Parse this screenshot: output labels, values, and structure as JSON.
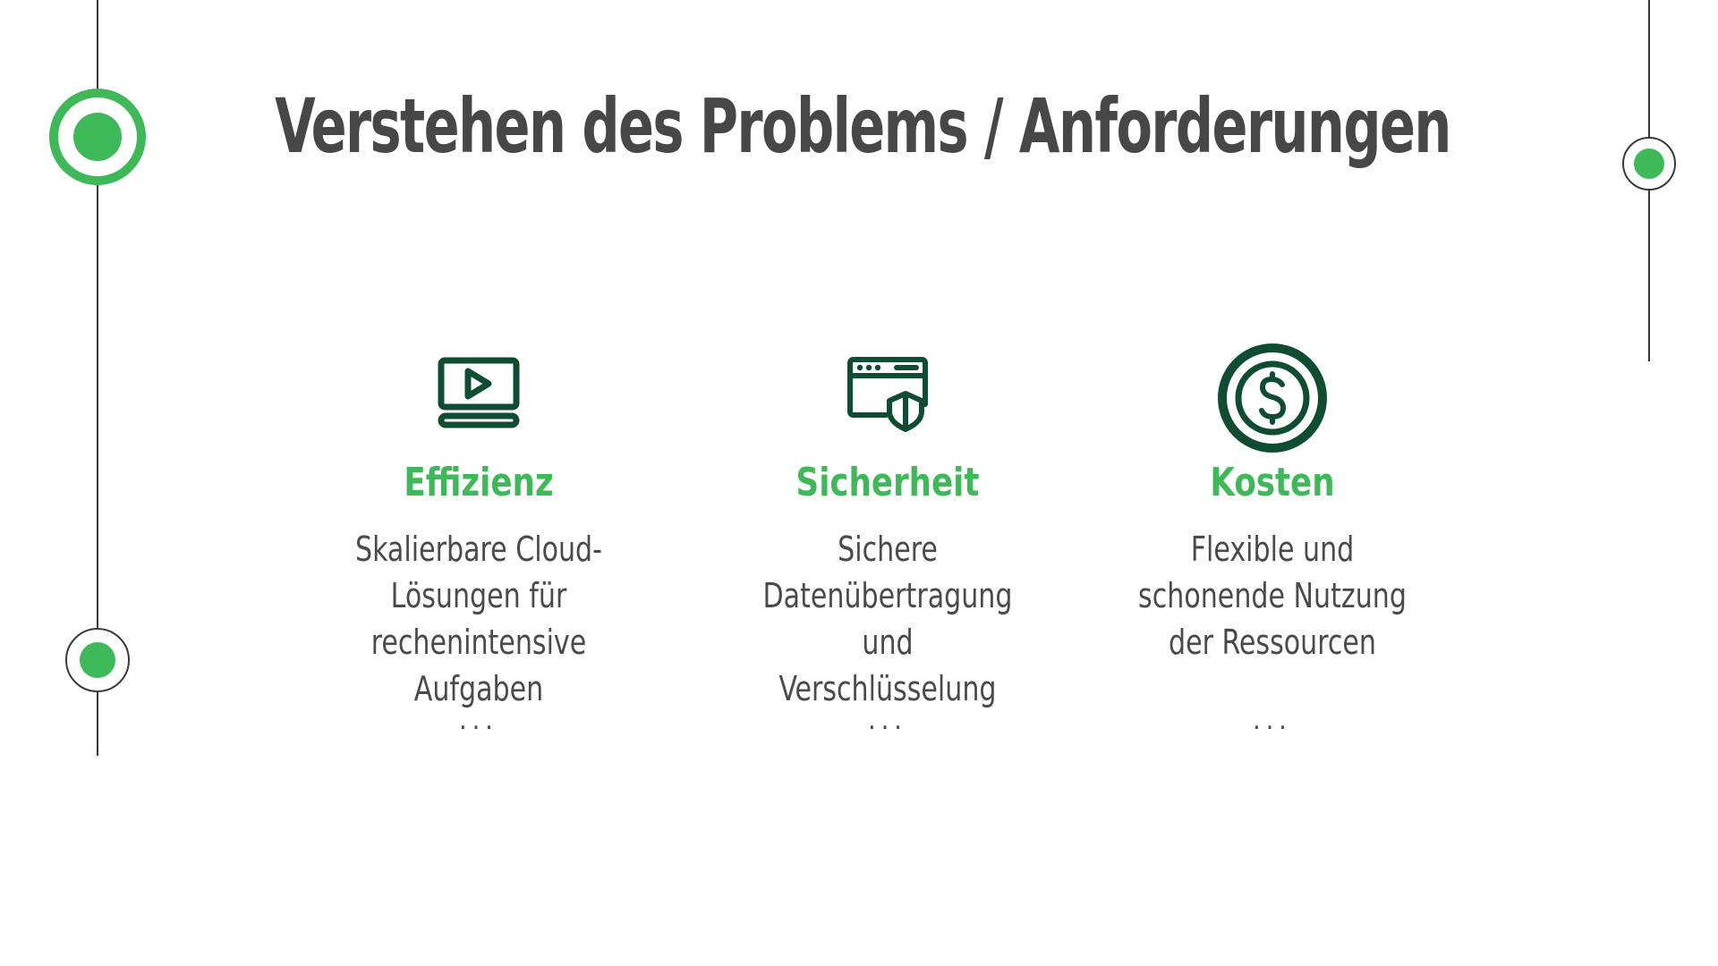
{
  "slide": {
    "title": "Verstehen des Problems / Anforderungen",
    "accent_color": "#3db957",
    "icon_color": "#0f4d33",
    "cards": [
      {
        "icon": "monitor-play-icon",
        "heading": "Effizienz",
        "desc_lines": [
          "Skalierbare Cloud-",
          "Lösungen für",
          "rechenintensive",
          "Aufgaben"
        ],
        "more": "..."
      },
      {
        "icon": "browser-shield-icon",
        "heading": "Sicherheit",
        "desc_lines": [
          "Sichere",
          "Datenübertragung",
          "und",
          "Verschlüsselung"
        ],
        "more": "..."
      },
      {
        "icon": "dollar-coin-icon",
        "heading": "Kosten",
        "desc_lines": [
          "Flexible und",
          "schonende Nutzung",
          "der Ressourcen"
        ],
        "more": "..."
      }
    ]
  }
}
